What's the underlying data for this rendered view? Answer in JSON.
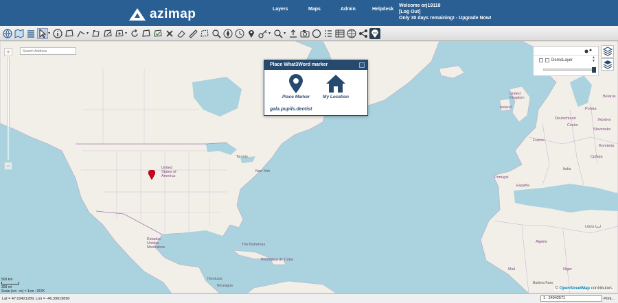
{
  "header": {
    "logo_text": "azimap",
    "nav": [
      "Layers",
      "Maps",
      "Admin",
      "Helpdesk"
    ],
    "welcome": "Welcome orj19119",
    "logout": "[Log Out]",
    "trial": "Only 30 days remaining! - Upgrade Now!"
  },
  "toolbar": {
    "tools": [
      "globe-icon",
      "book-map-icon",
      "layers-stack-icon",
      "select-arrow-icon",
      "info-icon",
      "draw-polygon-icon",
      "draw-line-icon",
      "vertex-edit-icon",
      "polygon-edit-icon",
      "polygon-add-icon",
      "refresh-icon",
      "polygon-icon",
      "polygon-check-icon",
      "delete-x-icon",
      "eraser-icon",
      "ruler-icon",
      "measure-area-icon",
      "zoom-area-icon",
      "compass-icon",
      "clock-icon",
      "pin-icon",
      "key-icon",
      "zoom-icon",
      "upload-icon",
      "camera-icon",
      "circle-icon",
      "list-icon",
      "table-icon",
      "globe-grid-icon",
      "share-icon",
      "what3words-icon"
    ]
  },
  "map": {
    "search_placeholder": "Search Address",
    "labels": [
      {
        "text": "United States of America",
        "cls": "country"
      },
      {
        "text": "Estados Unidos Mexicanos",
        "cls": "country"
      },
      {
        "text": "The Bahamas",
        "cls": "country"
      },
      {
        "text": "República de Cuba",
        "cls": "country"
      },
      {
        "text": "United Kingdom",
        "cls": "country"
      },
      {
        "text": "France",
        "cls": "country"
      },
      {
        "text": "España",
        "cls": "country"
      },
      {
        "text": "Portugal",
        "cls": "country"
      },
      {
        "text": "Deutschland",
        "cls": "country"
      },
      {
        "text": "Polska",
        "cls": "country"
      },
      {
        "text": "Italia",
        "cls": "country"
      },
      {
        "text": "Ireland",
        "cls": "country"
      },
      {
        "text": "Belarus",
        "cls": "country"
      },
      {
        "text": "Україна",
        "cls": "country"
      },
      {
        "text": "România",
        "cls": "country"
      },
      {
        "text": "Česko",
        "cls": "country"
      },
      {
        "text": "Slovensko",
        "cls": "country"
      },
      {
        "text": "Србија",
        "cls": "country"
      },
      {
        "text": "Libya ليبيا",
        "cls": "country"
      },
      {
        "text": "Mali",
        "cls": "country"
      },
      {
        "text": "Niger",
        "cls": "country"
      },
      {
        "text": "Algérie",
        "cls": "country"
      },
      {
        "text": "Toronto",
        "cls": ""
      },
      {
        "text": "New York",
        "cls": ""
      },
      {
        "text": "Honduras",
        "cls": ""
      },
      {
        "text": "Nicaragua",
        "cls": ""
      },
      {
        "text": "Burkina Faso",
        "cls": ""
      }
    ]
  },
  "w3w_dialog": {
    "title": "Place What3Word marker",
    "place_marker": "Place Marker",
    "my_location": "My Location",
    "words": "gala.pupils.dentist"
  },
  "layer_panel": {
    "layer_name": "DemoLayer",
    "opacity": 1.0
  },
  "scale": {
    "km": "500 km",
    "mi": "300 mi",
    "text": "Scale (cm : m) = 1cm : 267K"
  },
  "attribution": {
    "prefix": "©",
    "link": "OpenStreetMap",
    "suffix": "contributors"
  },
  "status": {
    "coords": "Lat = 47.02421289, Lon = -46.39919890",
    "scale_value": "1 : 34942571",
    "print": "Print..."
  }
}
